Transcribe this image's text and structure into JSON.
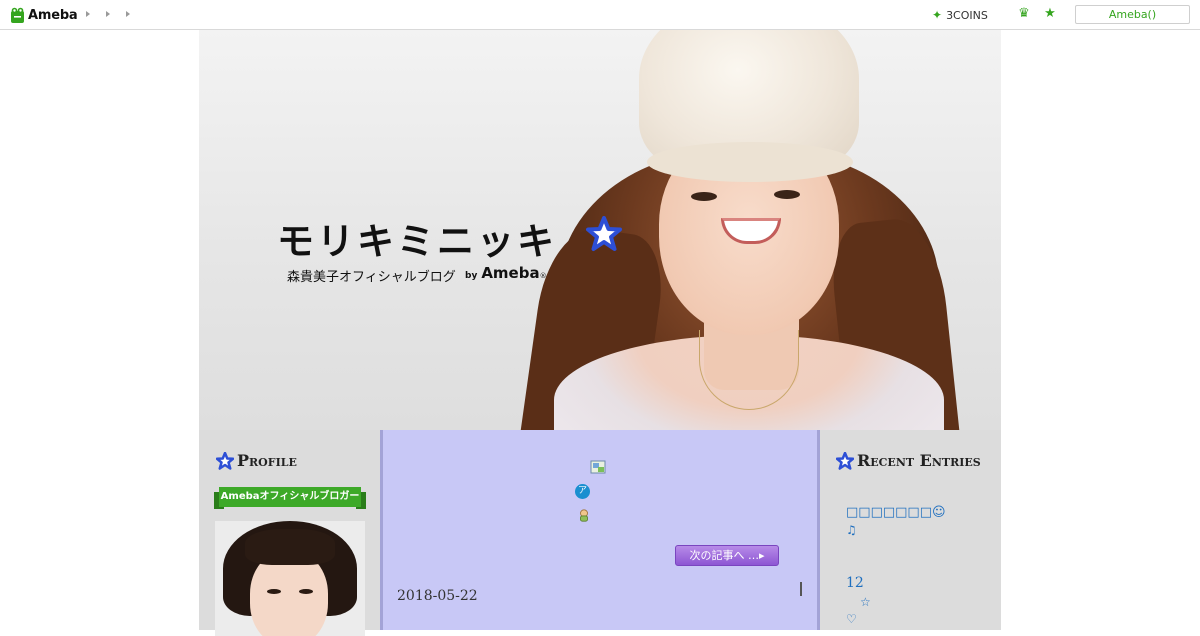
{
  "topbar": {
    "logo_text": "Ameba",
    "coins_label": "3COINS",
    "login_label": "Ameba()",
    "icons": [
      "frog-logo-icon",
      "crown-icon",
      "star-icon"
    ],
    "accent_color": "#35a51f"
  },
  "header": {
    "title": "モリキミニッキ",
    "subtitle": "森貴美子オフィシャルブログ",
    "by_text": "by",
    "by_brand": "Ameba",
    "by_mark": "®"
  },
  "profile": {
    "heading": "Profile",
    "badge": "Amebaオフィシャルブロガー"
  },
  "main": {
    "next_button": "次の記事へ …▸",
    "circle_icon_char": "ア",
    "cursor_char": "|",
    "date": "2018-05-22",
    "background_color": "#c8c8f6"
  },
  "recent": {
    "heading": "Recent Entries",
    "items": [
      {
        "text": "□□□□□□□☺",
        "sub": "♫"
      },
      {
        "text": "12",
        "sub": "☆",
        "sub2": "♡"
      }
    ]
  }
}
